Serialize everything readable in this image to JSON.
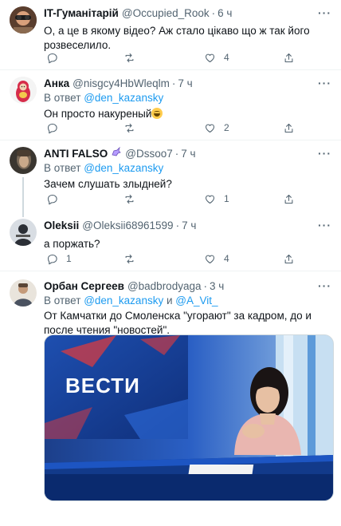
{
  "tweets": [
    {
      "name": "IT-Гуманітарій",
      "handle": "@Occupied_Rook",
      "dot": "·",
      "time": "6 ч",
      "text": "О, а це в якому відео? Аж стало цікаво що ж так його розвеселило.",
      "actions": {
        "replies": "",
        "retweets": "",
        "likes": "4"
      }
    },
    {
      "name": "Анка",
      "handle": "@nisgcy4HbWleqlm",
      "dot": "·",
      "time": "7 ч",
      "reply_prefix": "В ответ",
      "reply_to": "@den_kazansky",
      "text": "Он просто накуреный",
      "emoji": "grinning-face-emoji",
      "actions": {
        "replies": "",
        "retweets": "",
        "likes": "2"
      }
    },
    {
      "name": "ANTI FALSO",
      "badge_icon": "unicorn-icon",
      "handle": "@Dssoo7",
      "dot": "·",
      "time": "7 ч",
      "reply_prefix": "В ответ",
      "reply_to": "@den_kazansky",
      "text": "Зачем слушать злыдней?",
      "actions": {
        "replies": "",
        "retweets": "",
        "likes": "1"
      }
    },
    {
      "name": "Oleksii",
      "handle": "@Oleksii68961599",
      "dot": "·",
      "time": "7 ч",
      "text": "а поржать?",
      "actions": {
        "replies": "1",
        "retweets": "",
        "likes": "4"
      }
    },
    {
      "name": "Орбан Сергеев",
      "handle": "@badbrodyaga",
      "dot": "·",
      "time": "3 ч",
      "reply_prefix": "В ответ",
      "reply_to": "@den_kazansky",
      "reply_and": "и",
      "reply_to_2": "@A_Vit_",
      "text": "От Камчатки до Смоленска \"угорают\" за кадром, до и после чтения \"новостей\".",
      "media_logo": "ВЕСТИ"
    }
  ],
  "more_label": "···",
  "colors": {
    "accent": "#1d9bf0",
    "muted": "#536471",
    "text": "#0f1419",
    "border": "#eff3f4"
  }
}
